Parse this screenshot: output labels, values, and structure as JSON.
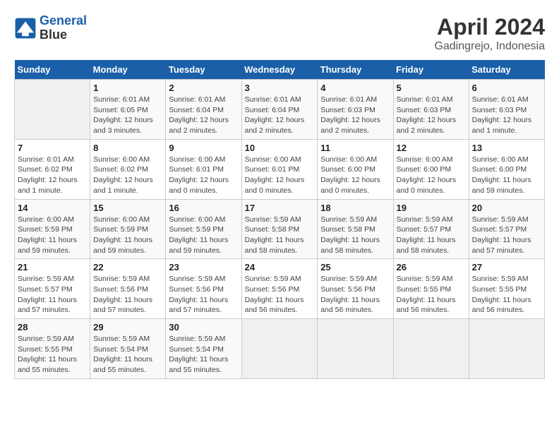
{
  "app": {
    "logo_line1": "General",
    "logo_line2": "Blue"
  },
  "title": "April 2024",
  "subtitle": "Gadingrejo, Indonesia",
  "header_days": [
    "Sunday",
    "Monday",
    "Tuesday",
    "Wednesday",
    "Thursday",
    "Friday",
    "Saturday"
  ],
  "weeks": [
    [
      {
        "day": "",
        "info": ""
      },
      {
        "day": "1",
        "info": "Sunrise: 6:01 AM\nSunset: 6:05 PM\nDaylight: 12 hours\nand 3 minutes."
      },
      {
        "day": "2",
        "info": "Sunrise: 6:01 AM\nSunset: 6:04 PM\nDaylight: 12 hours\nand 2 minutes."
      },
      {
        "day": "3",
        "info": "Sunrise: 6:01 AM\nSunset: 6:04 PM\nDaylight: 12 hours\nand 2 minutes."
      },
      {
        "day": "4",
        "info": "Sunrise: 6:01 AM\nSunset: 6:03 PM\nDaylight: 12 hours\nand 2 minutes."
      },
      {
        "day": "5",
        "info": "Sunrise: 6:01 AM\nSunset: 6:03 PM\nDaylight: 12 hours\nand 2 minutes."
      },
      {
        "day": "6",
        "info": "Sunrise: 6:01 AM\nSunset: 6:03 PM\nDaylight: 12 hours\nand 1 minute."
      }
    ],
    [
      {
        "day": "7",
        "info": "Sunrise: 6:01 AM\nSunset: 6:02 PM\nDaylight: 12 hours\nand 1 minute."
      },
      {
        "day": "8",
        "info": "Sunrise: 6:00 AM\nSunset: 6:02 PM\nDaylight: 12 hours\nand 1 minute."
      },
      {
        "day": "9",
        "info": "Sunrise: 6:00 AM\nSunset: 6:01 PM\nDaylight: 12 hours\nand 0 minutes."
      },
      {
        "day": "10",
        "info": "Sunrise: 6:00 AM\nSunset: 6:01 PM\nDaylight: 12 hours\nand 0 minutes."
      },
      {
        "day": "11",
        "info": "Sunrise: 6:00 AM\nSunset: 6:00 PM\nDaylight: 12 hours\nand 0 minutes."
      },
      {
        "day": "12",
        "info": "Sunrise: 6:00 AM\nSunset: 6:00 PM\nDaylight: 12 hours\nand 0 minutes."
      },
      {
        "day": "13",
        "info": "Sunrise: 6:00 AM\nSunset: 6:00 PM\nDaylight: 11 hours\nand 59 minutes."
      }
    ],
    [
      {
        "day": "14",
        "info": "Sunrise: 6:00 AM\nSunset: 5:59 PM\nDaylight: 11 hours\nand 59 minutes."
      },
      {
        "day": "15",
        "info": "Sunrise: 6:00 AM\nSunset: 5:59 PM\nDaylight: 11 hours\nand 59 minutes."
      },
      {
        "day": "16",
        "info": "Sunrise: 6:00 AM\nSunset: 5:59 PM\nDaylight: 11 hours\nand 59 minutes."
      },
      {
        "day": "17",
        "info": "Sunrise: 5:59 AM\nSunset: 5:58 PM\nDaylight: 11 hours\nand 58 minutes."
      },
      {
        "day": "18",
        "info": "Sunrise: 5:59 AM\nSunset: 5:58 PM\nDaylight: 11 hours\nand 58 minutes."
      },
      {
        "day": "19",
        "info": "Sunrise: 5:59 AM\nSunset: 5:57 PM\nDaylight: 11 hours\nand 58 minutes."
      },
      {
        "day": "20",
        "info": "Sunrise: 5:59 AM\nSunset: 5:57 PM\nDaylight: 11 hours\nand 57 minutes."
      }
    ],
    [
      {
        "day": "21",
        "info": "Sunrise: 5:59 AM\nSunset: 5:57 PM\nDaylight: 11 hours\nand 57 minutes."
      },
      {
        "day": "22",
        "info": "Sunrise: 5:59 AM\nSunset: 5:56 PM\nDaylight: 11 hours\nand 57 minutes."
      },
      {
        "day": "23",
        "info": "Sunrise: 5:59 AM\nSunset: 5:56 PM\nDaylight: 11 hours\nand 57 minutes."
      },
      {
        "day": "24",
        "info": "Sunrise: 5:59 AM\nSunset: 5:56 PM\nDaylight: 11 hours\nand 56 minutes."
      },
      {
        "day": "25",
        "info": "Sunrise: 5:59 AM\nSunset: 5:56 PM\nDaylight: 11 hours\nand 56 minutes."
      },
      {
        "day": "26",
        "info": "Sunrise: 5:59 AM\nSunset: 5:55 PM\nDaylight: 11 hours\nand 56 minutes."
      },
      {
        "day": "27",
        "info": "Sunrise: 5:59 AM\nSunset: 5:55 PM\nDaylight: 11 hours\nand 56 minutes."
      }
    ],
    [
      {
        "day": "28",
        "info": "Sunrise: 5:59 AM\nSunset: 5:55 PM\nDaylight: 11 hours\nand 55 minutes."
      },
      {
        "day": "29",
        "info": "Sunrise: 5:59 AM\nSunset: 5:54 PM\nDaylight: 11 hours\nand 55 minutes."
      },
      {
        "day": "30",
        "info": "Sunrise: 5:59 AM\nSunset: 5:54 PM\nDaylight: 11 hours\nand 55 minutes."
      },
      {
        "day": "",
        "info": ""
      },
      {
        "day": "",
        "info": ""
      },
      {
        "day": "",
        "info": ""
      },
      {
        "day": "",
        "info": ""
      }
    ]
  ]
}
